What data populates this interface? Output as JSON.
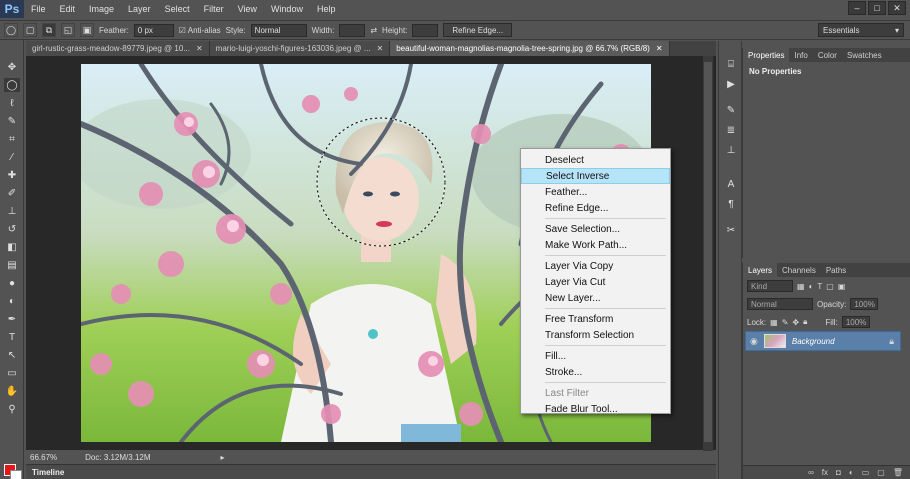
{
  "app": {
    "logo": "Ps"
  },
  "menu": [
    "File",
    "Edit",
    "Image",
    "Layer",
    "Select",
    "Filter",
    "View",
    "Window",
    "Help"
  ],
  "window_controls": [
    "–",
    "□",
    "✕"
  ],
  "options": {
    "feather_label": "Feather:",
    "feather_value": "0 px",
    "antialias_label": "Anti-alias",
    "style_label": "Style:",
    "style_value": "Normal",
    "width_label": "Width:",
    "height_label": "Height:",
    "refine_edge": "Refine Edge...",
    "workspace": "Essentials"
  },
  "tabs": [
    {
      "label": "girl-rustic-grass-meadow-89779.jpeg @ 10...",
      "close": "✕"
    },
    {
      "label": "mario-luigi-yoschi-figures-163036.jpeg @ ...",
      "close": "✕"
    },
    {
      "label": "beautiful-woman-magnolias-magnolia-tree-spring.jpg @ 66.7% (RGB/8)",
      "close": "✕"
    }
  ],
  "context_menu": [
    {
      "label": "Deselect",
      "state": "normal"
    },
    {
      "label": "Select Inverse",
      "state": "hover"
    },
    {
      "label": "Feather...",
      "state": "normal"
    },
    {
      "label": "Refine Edge...",
      "state": "normal"
    },
    {
      "sep": true
    },
    {
      "label": "Save Selection...",
      "state": "normal"
    },
    {
      "label": "Make Work Path...",
      "state": "normal"
    },
    {
      "sep": true
    },
    {
      "label": "Layer Via Copy",
      "state": "normal"
    },
    {
      "label": "Layer Via Cut",
      "state": "normal"
    },
    {
      "label": "New Layer...",
      "state": "normal"
    },
    {
      "sep": true
    },
    {
      "label": "Free Transform",
      "state": "normal"
    },
    {
      "label": "Transform Selection",
      "state": "normal"
    },
    {
      "sep": true
    },
    {
      "label": "Fill...",
      "state": "normal"
    },
    {
      "label": "Stroke...",
      "state": "normal"
    },
    {
      "sep": true
    },
    {
      "label": "Last Filter",
      "state": "disabled"
    },
    {
      "label": "Fade Blur Tool...",
      "state": "normal"
    }
  ],
  "status": {
    "zoom": "66.67%",
    "doc": "Doc: 3.12M/3.12M"
  },
  "timeline": "Timeline",
  "properties": {
    "tabs": [
      "Properties",
      "Info",
      "Color",
      "Swatches"
    ],
    "content": "No Properties"
  },
  "layers": {
    "tabs": [
      "Layers",
      "Channels",
      "Paths"
    ],
    "kind": "Kind",
    "blend_mode": "Normal",
    "opacity_label": "Opacity:",
    "opacity_value": "100%",
    "lock_label": "Lock:",
    "fill_label": "Fill:",
    "fill_value": "100%",
    "layer_name": "Background"
  },
  "colors": {
    "foreground": "#e8141a",
    "background": "#ffffff",
    "menu_hover": "#b5e3f7"
  }
}
